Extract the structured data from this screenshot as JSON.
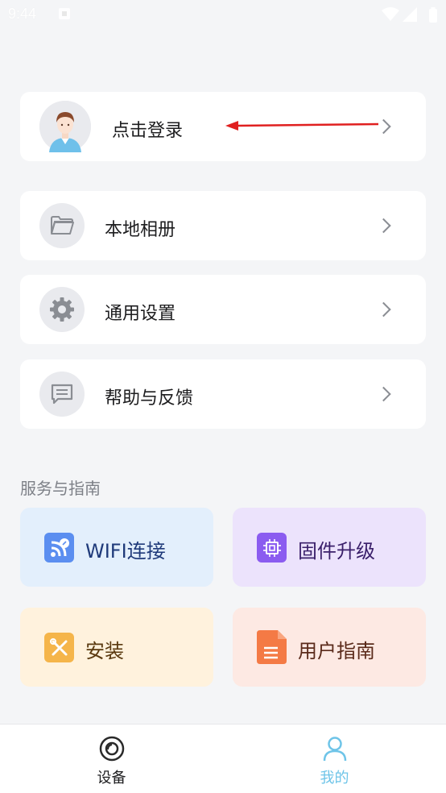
{
  "status_bar": {
    "time": "9:44"
  },
  "profile": {
    "login_label": "点击登录"
  },
  "menu": [
    {
      "label": "本地相册",
      "icon": "folder-icon"
    },
    {
      "label": "通用设置",
      "icon": "gear-icon"
    },
    {
      "label": "帮助与反馈",
      "icon": "message-icon"
    }
  ],
  "services": {
    "title": "服务与指南",
    "tiles": [
      {
        "label": "WIFI连接",
        "icon": "wifi-link-icon",
        "bg": "#e3effc",
        "accent": "#5b8ef0",
        "text": "#1f3a7a"
      },
      {
        "label": "固件升级",
        "icon": "chip-icon",
        "bg": "#ece3fc",
        "accent": "#8b5cf0",
        "text": "#3a1f6a"
      },
      {
        "label": "安装",
        "icon": "tools-icon",
        "bg": "#fff2dd",
        "accent": "#f5b54a",
        "text": "#5a3a10"
      },
      {
        "label": "用户指南",
        "icon": "document-icon",
        "bg": "#fde9e3",
        "accent": "#f47a45",
        "text": "#5a2a1a"
      }
    ]
  },
  "tabbar": {
    "tabs": [
      {
        "label": "设备",
        "icon": "device-icon",
        "active": false
      },
      {
        "label": "我的",
        "icon": "profile-icon",
        "active": true
      }
    ],
    "active_color": "#6ec4e8",
    "inactive_color": "#1d1d1f"
  }
}
